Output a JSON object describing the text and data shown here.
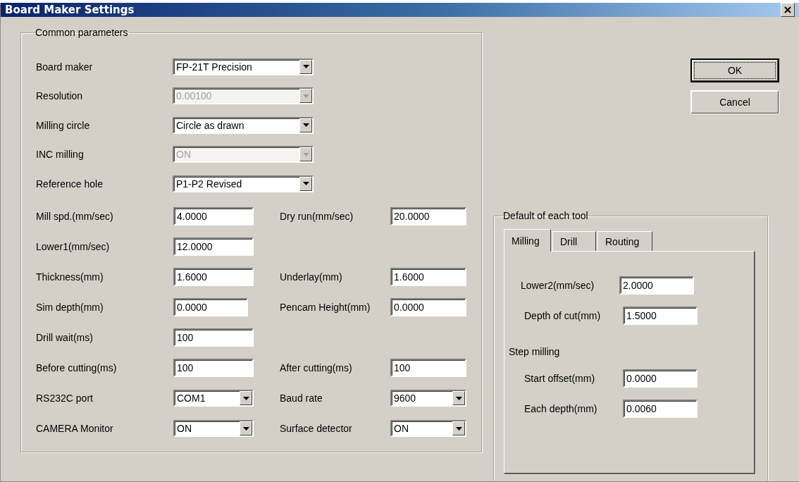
{
  "window": {
    "title": "Board Maker Settings"
  },
  "common_parameters": {
    "title": "Common parameters",
    "dropdowns": [
      {
        "label": "Board maker",
        "value": "FP-21T Precision",
        "disabled": false
      },
      {
        "label": "Resolution",
        "value": "0.00100",
        "disabled": true
      },
      {
        "label": "Milling circle",
        "value": "Circle as drawn",
        "disabled": false
      },
      {
        "label": "INC milling",
        "value": "ON",
        "disabled": true
      },
      {
        "label": "Reference hole",
        "value": "P1-P2 Revised",
        "disabled": false
      }
    ],
    "rows": [
      [
        {
          "label": "Mill spd.(mm/sec)",
          "value": "4.0000",
          "kind": "text"
        },
        {
          "label": "Dry run(mm/sec)",
          "value": "20.0000",
          "kind": "text"
        }
      ],
      [
        {
          "label": "Lower1(mm/sec)",
          "value": "12.0000",
          "kind": "text"
        }
      ],
      [
        {
          "label": "Thickness(mm)",
          "value": "1.6000",
          "kind": "text"
        },
        {
          "label": "Underlay(mm)",
          "value": "1.6000",
          "kind": "text"
        }
      ],
      [
        {
          "label": "Sim depth(mm)",
          "value": "0.0000",
          "kind": "text"
        },
        {
          "label": "Pencam Height(mm)",
          "value": "0.0000",
          "kind": "text"
        }
      ],
      [
        {
          "label": "Drill wait(ms)",
          "value": "100",
          "kind": "text"
        }
      ],
      [
        {
          "label": "Before cutting(ms)",
          "value": "100",
          "kind": "text"
        },
        {
          "label": "After cutting(ms)",
          "value": "100",
          "kind": "text"
        }
      ],
      [
        {
          "label": "RS232C port",
          "value": "COM1",
          "kind": "select"
        },
        {
          "label": "Baud rate",
          "value": "9600",
          "kind": "select"
        }
      ],
      [
        {
          "label": "CAMERA Monitor",
          "value": "ON",
          "kind": "select"
        },
        {
          "label": "Surface detector",
          "value": "ON",
          "kind": "select"
        }
      ]
    ]
  },
  "buttons": [
    {
      "label": "OK",
      "default": true
    },
    {
      "label": "Cancel",
      "default": false
    }
  ],
  "tool_defaults": {
    "title": "Default of each tool",
    "tabs": [
      {
        "label": "Milling",
        "selected": true
      },
      {
        "label": "Drill",
        "selected": false
      },
      {
        "label": "Routing",
        "selected": false
      }
    ],
    "fields": [
      {
        "label": "Lower2(mm/sec)",
        "value": "2.0000"
      },
      {
        "label": "Depth of cut(mm)",
        "value": "1.5000"
      }
    ],
    "step_milling": {
      "title": "Step milling",
      "fields": [
        {
          "label": "Start offset(mm)",
          "value": "0.0000"
        },
        {
          "label": "Each depth(mm)",
          "value": "0.0060"
        }
      ]
    }
  }
}
